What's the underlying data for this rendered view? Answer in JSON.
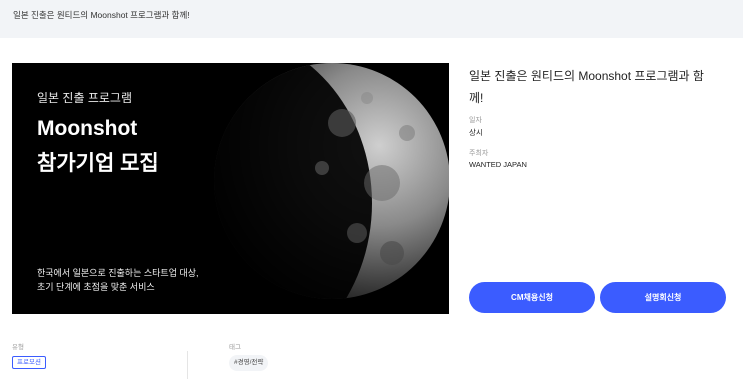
{
  "header": {
    "title": "일본 진출은 원티드의 Moonshot 프로그램과 함께!"
  },
  "banner": {
    "kicker": "일본 진출 프로그램",
    "headline_line1": "Moonshot",
    "headline_line2": "참가기업 모집",
    "desc_line1": "한국에서 일본으로 진출하는 스타트업 대상,",
    "desc_line2": "초기 단계에 초점을 맞춘 서비스"
  },
  "info": {
    "title_line1": "일본 진출은 원티드의 Moonshot 프로그램과 함",
    "title_line2": "께!",
    "date_label": "일자",
    "date_value": "상시",
    "host_label": "주최자",
    "host_value": "WANTED JAPAN"
  },
  "actions": {
    "cm_apply": "CM채용신청",
    "info_session": "설명회신청"
  },
  "meta": {
    "type_label": "유형",
    "type_value": "프로모션",
    "tag_label": "태그",
    "tag_value": "#경영/전략"
  },
  "colors": {
    "accent": "#3b5cff",
    "topbar_bg": "#f2f4f7"
  }
}
